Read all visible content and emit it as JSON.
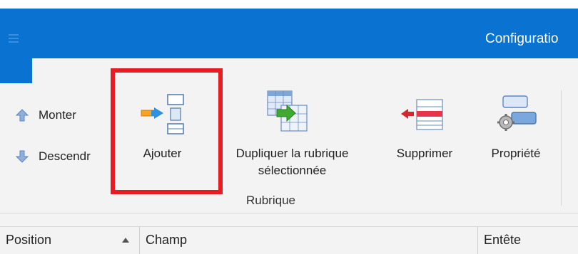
{
  "window": {
    "title": "Configuratio"
  },
  "ribbon": {
    "small_buttons": [
      {
        "label": "Monter",
        "icon": "arrow-up-icon"
      },
      {
        "label": "Descendr",
        "icon": "arrow-down-icon"
      }
    ],
    "big_buttons": [
      {
        "label": "Ajouter",
        "icon": "add-field-icon"
      },
      {
        "label": "Dupliquer la rubrique",
        "label2": "sélectionnée",
        "icon": "duplicate-field-icon"
      },
      {
        "label": "Supprimer",
        "icon": "delete-field-icon"
      },
      {
        "label": "Propriété",
        "icon": "properties-icon"
      }
    ],
    "group_label": "Rubrique",
    "highlight_color": "#e81b23"
  },
  "grid": {
    "columns": [
      {
        "label": "Position",
        "sorted": "ascending"
      },
      {
        "label": "Champ"
      },
      {
        "label": "Entête"
      }
    ]
  },
  "colors": {
    "title_bar": "#0a72d0",
    "ribbon_bg": "#f3f3f3"
  }
}
